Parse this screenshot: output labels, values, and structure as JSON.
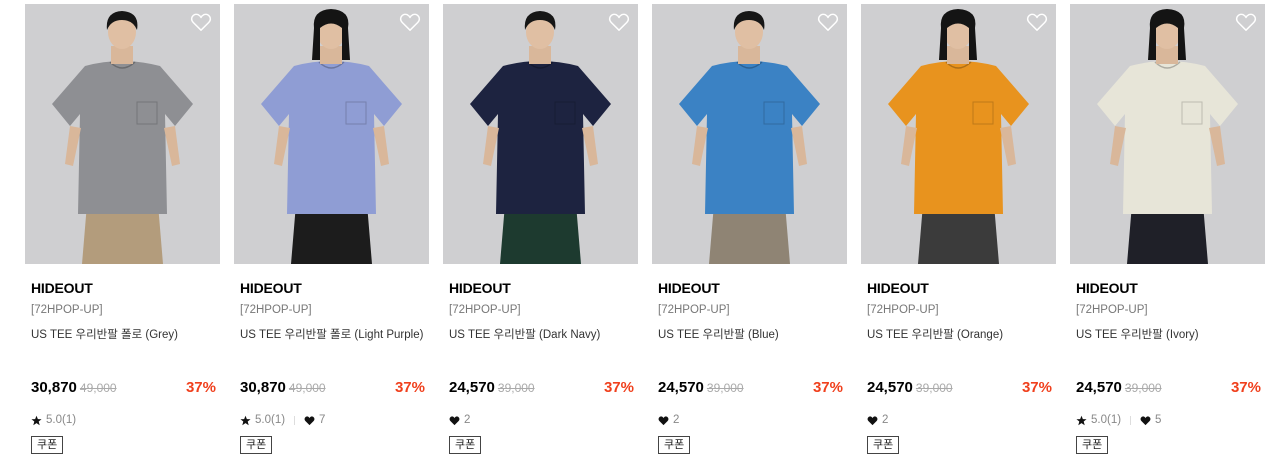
{
  "products": [
    {
      "brand": "HIDEOUT",
      "promo": "[72HPOP-UP]",
      "name": "US TEE 우리반팔 폴로 (Grey)",
      "price": "30,870",
      "original_price": "49,000",
      "discount": "37%",
      "rating": "5.0(1)",
      "likes": "",
      "coupon": "쿠폰",
      "shirt_color": "#8e8f93",
      "pants_color": "#b39c7c",
      "hair": "short"
    },
    {
      "brand": "HIDEOUT",
      "promo": "[72HPOP-UP]",
      "name": "US TEE 우리반팔 폴로 (Light Purple)",
      "price": "30,870",
      "original_price": "49,000",
      "discount": "37%",
      "rating": "5.0(1)",
      "likes": "7",
      "coupon": "쿠폰",
      "shirt_color": "#8f9dd4",
      "pants_color": "#1c1c1c",
      "hair": "bob"
    },
    {
      "brand": "HIDEOUT",
      "promo": "[72HPOP-UP]",
      "name": "US TEE 우리반팔 (Dark Navy)",
      "price": "24,570",
      "original_price": "39,000",
      "discount": "37%",
      "rating": "",
      "likes": "2",
      "coupon": "쿠폰",
      "shirt_color": "#1d2340",
      "pants_color": "#1d3a2f",
      "hair": "short"
    },
    {
      "brand": "HIDEOUT",
      "promo": "[72HPOP-UP]",
      "name": "US TEE 우리반팔 (Blue)",
      "price": "24,570",
      "original_price": "39,000",
      "discount": "37%",
      "rating": "",
      "likes": "2",
      "coupon": "쿠폰",
      "shirt_color": "#3b82c4",
      "pants_color": "#8f8474",
      "hair": "short"
    },
    {
      "brand": "HIDEOUT",
      "promo": "[72HPOP-UP]",
      "name": "US TEE 우리반팔 (Orange)",
      "price": "24,570",
      "original_price": "39,000",
      "discount": "37%",
      "rating": "",
      "likes": "2",
      "coupon": "쿠폰",
      "shirt_color": "#e8931e",
      "pants_color": "#3b3b3b",
      "hair": "bob"
    },
    {
      "brand": "HIDEOUT",
      "promo": "[72HPOP-UP]",
      "name": "US TEE 우리반팔 (Ivory)",
      "price": "24,570",
      "original_price": "39,000",
      "discount": "37%",
      "rating": "5.0(1)",
      "likes": "5",
      "coupon": "쿠폰",
      "shirt_color": "#e7e5d8",
      "pants_color": "#1f2028",
      "hair": "bob"
    }
  ]
}
